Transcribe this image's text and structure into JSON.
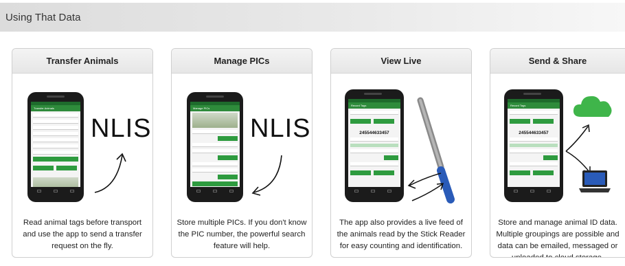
{
  "section": {
    "title": "Using That Data"
  },
  "cards": [
    {
      "title": "Transfer Animals",
      "logo": "NLIS",
      "description": "Read animal tags before transport and use the app to send a transfer request on the fly."
    },
    {
      "title": "Manage PICs",
      "logo": "NLIS",
      "description": "Store multiple PICs. If you don't know the PIC number, the powerful search feature will help."
    },
    {
      "title": "View Live",
      "screen_number": "245544633457",
      "description": "The app also provides a live feed of the animals read by the Stick Reader for easy counting and identification."
    },
    {
      "title": "Send & Share",
      "screen_number": "245544633457",
      "description": "Store and manage animal ID data. Multiple groupings are possible and data can be emailed, messaged or uploaded to cloud storage."
    }
  ],
  "colors": {
    "accent_green": "#2e9b3f",
    "cloud_green": "#3fb54a",
    "stick_blue": "#2a5bb8"
  }
}
